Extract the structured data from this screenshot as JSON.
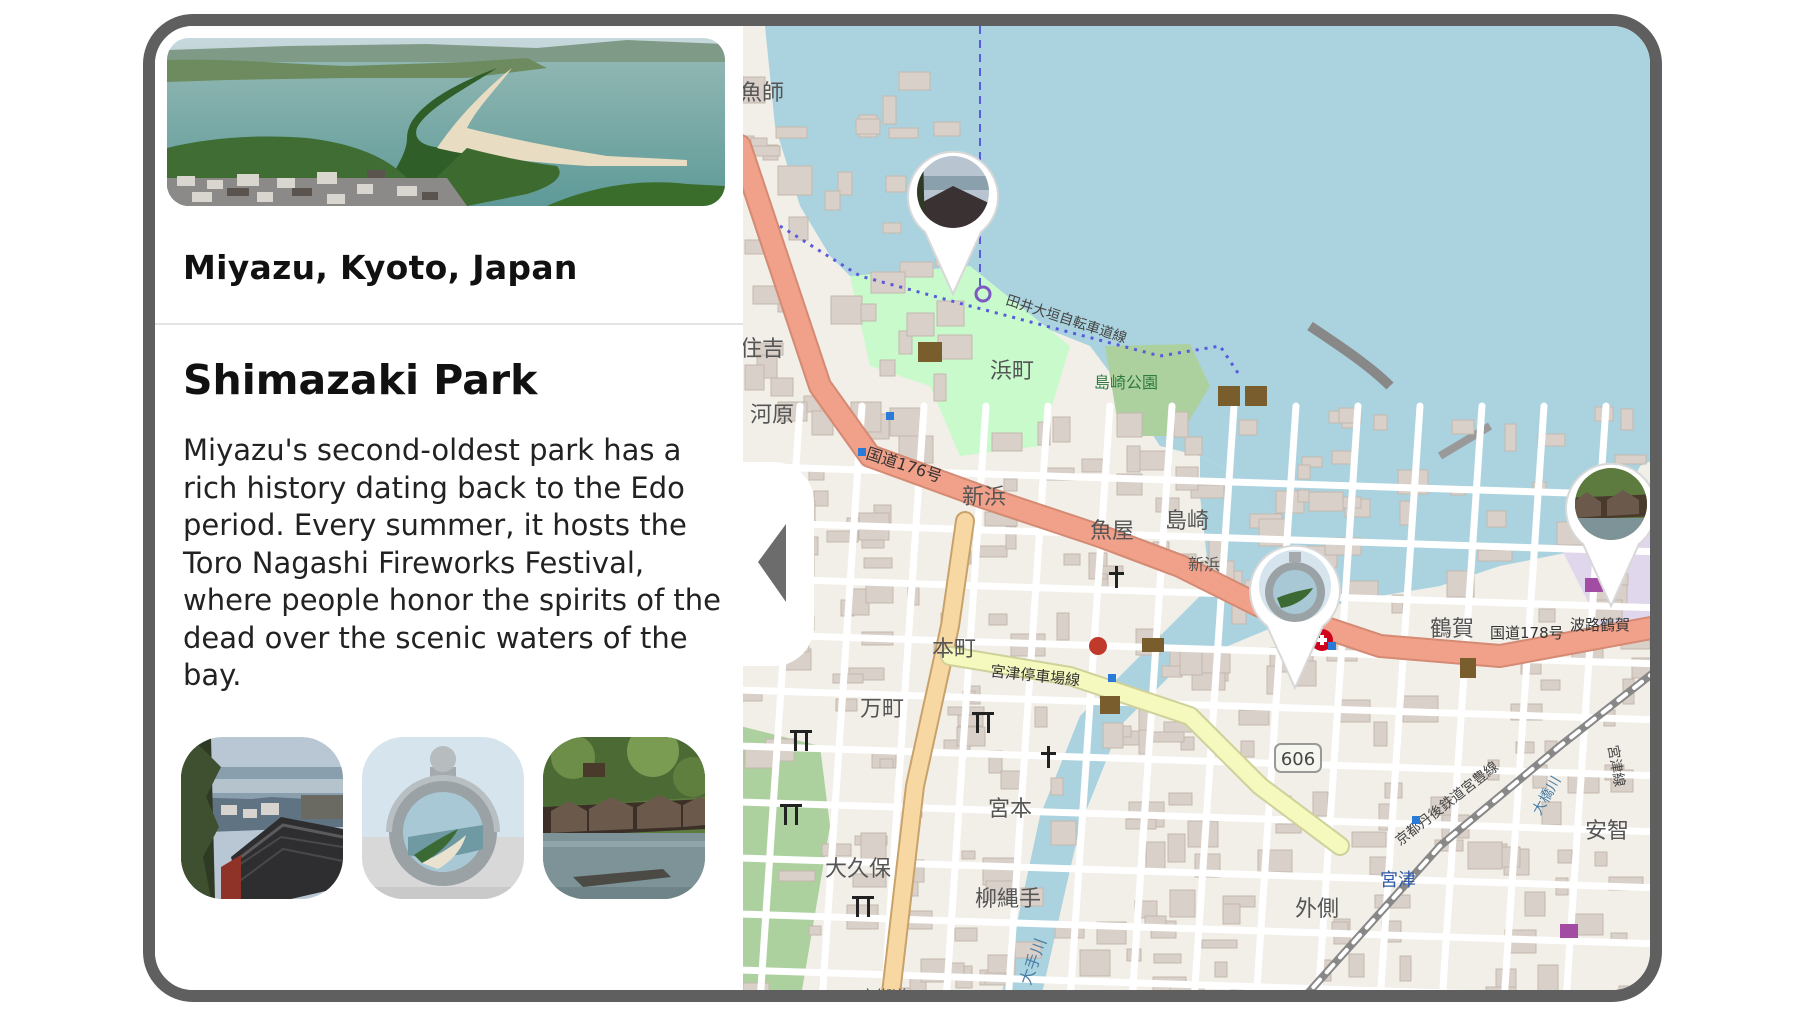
{
  "location": "Miyazu, Kyoto, Japan",
  "place": {
    "title": "Shimazaki Park",
    "description": "Miyazu's second-oldest park has a rich history dating back to the Edo period. Every summer, it hosts the Toro Nagashi Fireworks Festival, where people honor the spirits of the dead over the scenic waters of the bay."
  },
  "map_labels": {
    "fisherman": "魚師",
    "sumiyoshi": "住吉",
    "kawara": "河原",
    "hamamachi": "浜町",
    "shimazaki_park": "島崎公園",
    "cycling_road": "田井大垣自転車道線",
    "route176": "国道176号",
    "shinhama": "新浜",
    "uoya": "魚屋",
    "shimazaki": "島崎",
    "shinhama2": "新浜",
    "tsuruga": "鶴賀",
    "route178": "国道178号",
    "harotsuruga": "波路鶴賀",
    "honmachi": "本町",
    "station_line": "宮津停車場線",
    "manmachi": "万町",
    "route606": "606",
    "miyamoto": "宮本",
    "okubo": "大久保",
    "yanagi": "柳縄手",
    "sotogawa": "外側",
    "miyazu_station": "宮津",
    "ochi": "安智",
    "otegawa": "大手川",
    "railway": "京都丹後鉄道宮豊線",
    "miyazu_line": "宮津線",
    "ohashi": "大橋川",
    "kyokaido": "京街道"
  },
  "icons": {
    "collapse": "chevron-left-icon",
    "pins": [
      "temple-photo-pin",
      "stone-ring-photo-pin",
      "boathouse-photo-pin"
    ]
  },
  "colors": {
    "water": "#aad3df",
    "land": "#f2efe9",
    "building": "#d9d0c9",
    "park": "#c8facc",
    "primary_road": "#f1a08a",
    "secondary_road": "#f7d7a2",
    "tertiary_road": "#f6f9be",
    "frame": "#5f5f5f"
  }
}
